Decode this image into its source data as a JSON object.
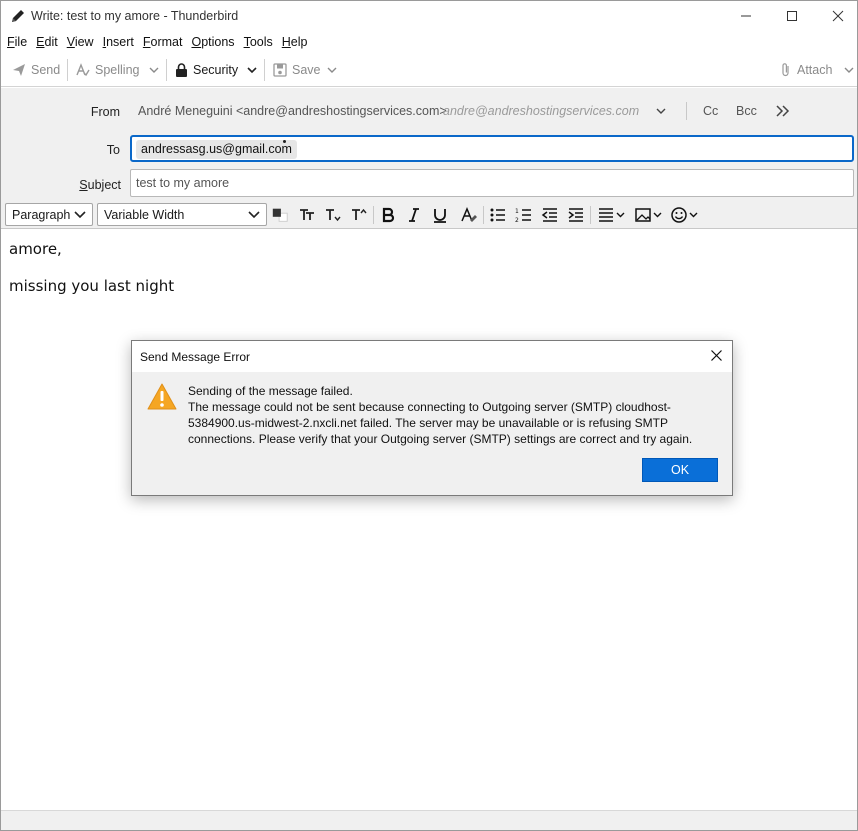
{
  "window": {
    "title": "Write: test to my amore - Thunderbird"
  },
  "menu": {
    "items": [
      {
        "label": "File",
        "accel": "F",
        "rest": "ile"
      },
      {
        "label": "Edit",
        "accel": "E",
        "rest": "dit"
      },
      {
        "label": "View",
        "accel": "V",
        "rest": "iew"
      },
      {
        "label": "Insert",
        "accel": "I",
        "rest": "nsert"
      },
      {
        "label": "Format",
        "accel": "F",
        "rest": "ormat"
      },
      {
        "label": "Options",
        "accel": "O",
        "rest": "ptions"
      },
      {
        "label": "Tools",
        "accel": "T",
        "rest": "ools"
      },
      {
        "label": "Help",
        "accel": "H",
        "rest": "elp"
      }
    ]
  },
  "toolbar": {
    "send_label": "Send",
    "spelling_label": "Spelling",
    "security_label": "Security",
    "save_label": "Save",
    "attach_label": "Attach"
  },
  "header": {
    "from_label": "From",
    "from_value": "André Meneguini <andre@andreshostingservices.com>",
    "from_hint": "andre@andreshostingservices.com",
    "cc_label": "Cc",
    "bcc_label": "Bcc",
    "to_label": "To",
    "to_recipient": "andressasg.us@gmail.com",
    "subject_label": "Subject",
    "subject_value": "test to my amore"
  },
  "format": {
    "paragraph_select": "Paragraph",
    "font_select": "Variable Width"
  },
  "body": {
    "line1": "amore,",
    "line2": "missing you last night"
  },
  "dialog": {
    "title": "Send Message Error",
    "message_heading": "Sending of the message failed.",
    "message_body": "The message could not be sent because connecting to Outgoing server (SMTP) cloudhost-5384900.us-midwest-2.nxcli.net failed. The server may be unavailable or is refusing SMTP connections. Please verify that your Outgoing server (SMTP) settings are correct and try again.",
    "ok_label": "OK"
  },
  "colors": {
    "accent": "#0a6fd8",
    "warning": "#f5a623",
    "focus_border": "#0a68c9"
  }
}
